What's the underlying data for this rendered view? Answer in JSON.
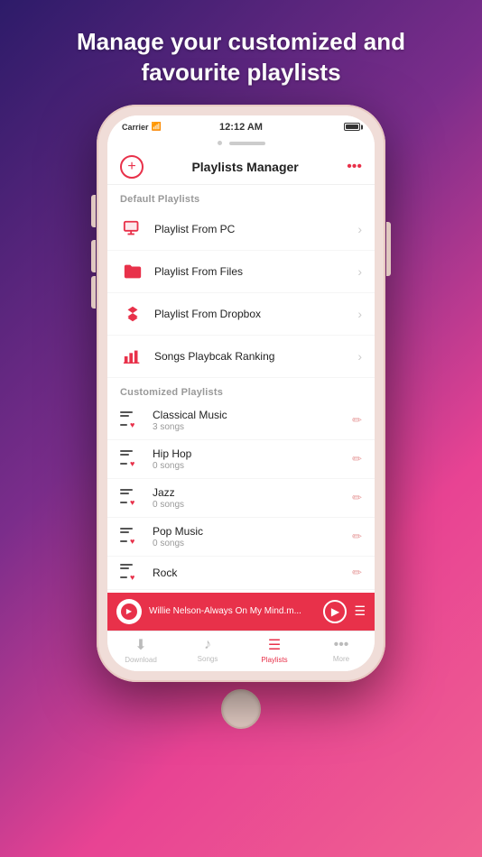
{
  "headline": "Manage your customized and favourite playlists",
  "status_bar": {
    "carrier": "Carrier",
    "time": "12:12 AM"
  },
  "header": {
    "title": "Playlists Manager",
    "more_label": "•••"
  },
  "default_section": {
    "label": "Default Playlists",
    "items": [
      {
        "id": "playlist-from-pc",
        "name": "Playlist From PC"
      },
      {
        "id": "playlist-from-files",
        "name": "Playlist From Files"
      },
      {
        "id": "playlist-from-dropbox",
        "name": "Playlist From Dropbox"
      },
      {
        "id": "songs-ranking",
        "name": "Songs Playbcak Ranking"
      }
    ]
  },
  "custom_section": {
    "label": "Customized Playlists",
    "items": [
      {
        "id": "classical-music",
        "name": "Classical Music",
        "songs": "3 songs"
      },
      {
        "id": "hip-hop",
        "name": "Hip Hop",
        "songs": "0 songs"
      },
      {
        "id": "jazz",
        "name": "Jazz",
        "songs": "0 songs"
      },
      {
        "id": "pop-music",
        "name": "Pop Music",
        "songs": "0 songs"
      },
      {
        "id": "rock",
        "name": "Rock",
        "songs": ""
      }
    ]
  },
  "player": {
    "track": "Willie Nelson-Always On My Mind.m..."
  },
  "tabs": [
    {
      "id": "download",
      "label": "Download",
      "icon": "⬇",
      "active": false
    },
    {
      "id": "songs",
      "label": "Songs",
      "icon": "♪",
      "active": false
    },
    {
      "id": "playlists",
      "label": "Playlists",
      "icon": "☰",
      "active": true
    },
    {
      "id": "more",
      "label": "More",
      "icon": "•••",
      "active": false
    }
  ]
}
